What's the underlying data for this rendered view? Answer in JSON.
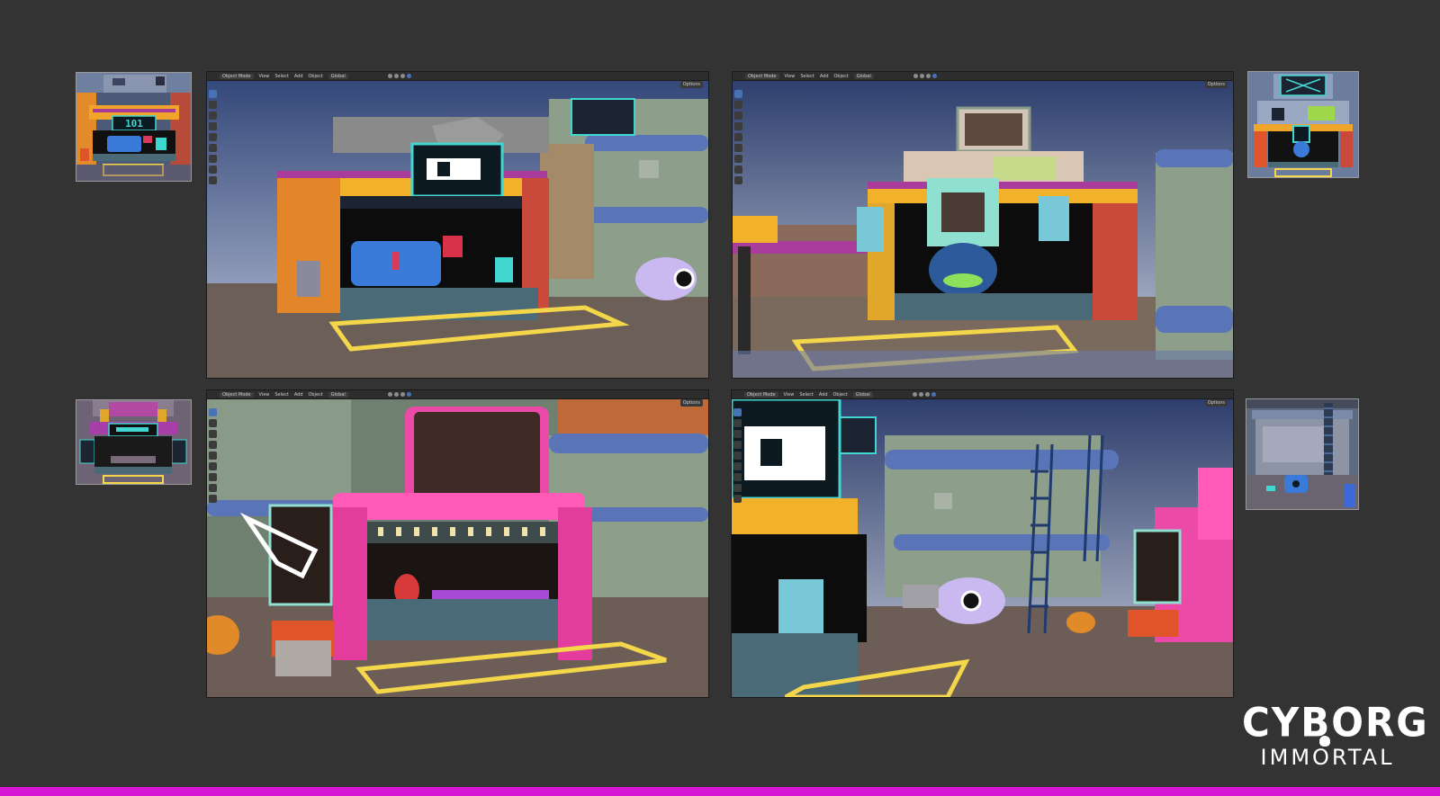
{
  "viewport_ui": {
    "mode": "Object Mode",
    "menus": [
      "View",
      "Select",
      "Add",
      "Object"
    ],
    "transform": "Global",
    "options": "Options"
  },
  "thumbnail_labels": {
    "sign_101": "101"
  },
  "logo": {
    "top": "CYBORG",
    "bottom": "IMMORTAL"
  },
  "colors": {
    "background": "#333333",
    "accent_bar": "#d715d4",
    "viewport_header": "#2d2d2d",
    "active_tool": "#4772b3"
  }
}
